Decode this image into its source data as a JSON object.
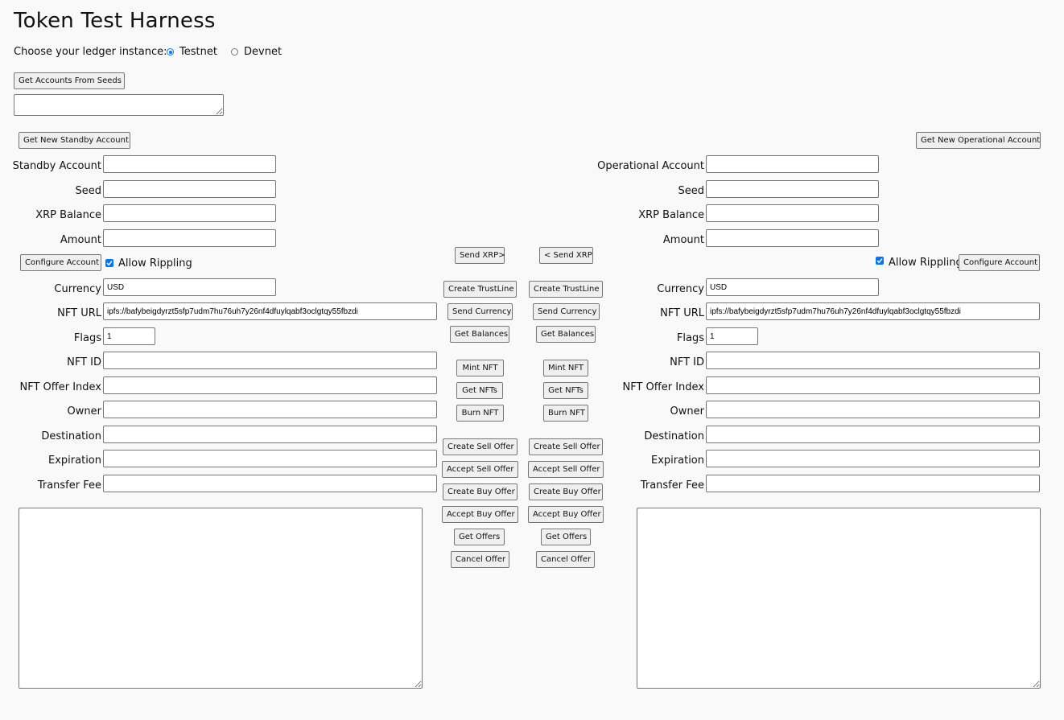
{
  "title": "Token Test Harness",
  "ledger": {
    "prompt": "Choose your ledger instance:",
    "options": [
      "Testnet",
      "Devnet"
    ],
    "selected": "Testnet"
  },
  "seeds": {
    "button": "Get Accounts From Seeds",
    "value": ""
  },
  "standby": {
    "new_account_button": "Get New Standby Account",
    "account_label": "Standby Account",
    "seed_label": "Seed",
    "balance_label": "XRP Balance",
    "amount_label": "Amount",
    "configure_button": "Configure Account",
    "allow_rippling_label": "Allow Rippling",
    "allow_rippling": true,
    "currency_label": "Currency",
    "currency_value": "USD",
    "nft_url_label": "NFT URL",
    "nft_url_value": "ipfs://bafybeigdyrzt5sfp7udm7hu76uh7y26nf4dfuylqabf3oclgtqy55fbzdi",
    "flags_label": "Flags",
    "flags_value": "1",
    "nft_id_label": "NFT ID",
    "offer_index_label": "NFT Offer Index",
    "owner_label": "Owner",
    "destination_label": "Destination",
    "expiration_label": "Expiration",
    "transfer_fee_label": "Transfer Fee",
    "results": ""
  },
  "operational": {
    "new_account_button": "Get New Operational Account",
    "account_label": "Operational Account",
    "seed_label": "Seed",
    "balance_label": "XRP Balance",
    "amount_label": "Amount",
    "configure_button": "Configure Account",
    "allow_rippling_label": "Allow Rippling",
    "allow_rippling": true,
    "currency_label": "Currency",
    "currency_value": "USD",
    "nft_url_label": "NFT URL",
    "nft_url_value": "ipfs://bafybeigdyrzt5sfp7udm7hu76uh7y26nf4dfuylqabf3oclgtqy55fbzdi",
    "flags_label": "Flags",
    "flags_value": "1",
    "nft_id_label": "NFT ID",
    "offer_index_label": "NFT Offer Index",
    "owner_label": "Owner",
    "destination_label": "Destination",
    "expiration_label": "Expiration",
    "transfer_fee_label": "Transfer Fee",
    "results": ""
  },
  "actions": {
    "standby": {
      "send_xrp": "Send XRP>",
      "create_trustline": "Create TrustLine",
      "send_currency": "Send Currency",
      "get_balances": "Get Balances",
      "mint_nft": "Mint NFT",
      "get_nfts": "Get NFTs",
      "burn_nft": "Burn NFT",
      "create_sell_offer": "Create Sell Offer",
      "accept_sell_offer": "Accept Sell Offer",
      "create_buy_offer": "Create Buy Offer",
      "accept_buy_offer": "Accept Buy Offer",
      "get_offers": "Get Offers",
      "cancel_offer": "Cancel Offer"
    },
    "operational": {
      "send_xrp": "< Send XRP",
      "create_trustline": "Create TrustLine",
      "send_currency": "Send Currency",
      "get_balances": "Get Balances",
      "mint_nft": "Mint NFT",
      "get_nfts": "Get NFTs",
      "burn_nft": "Burn NFT",
      "create_sell_offer": "Create Sell Offer",
      "accept_sell_offer": "Accept Sell Offer",
      "create_buy_offer": "Create Buy Offer",
      "accept_buy_offer": "Accept Buy Offer",
      "get_offers": "Get Offers",
      "cancel_offer": "Cancel Offer"
    }
  },
  "colors": {
    "accent": "#0075ff",
    "background": "#f9f9f9",
    "button_bg": "#efefef",
    "border": "#767676"
  }
}
